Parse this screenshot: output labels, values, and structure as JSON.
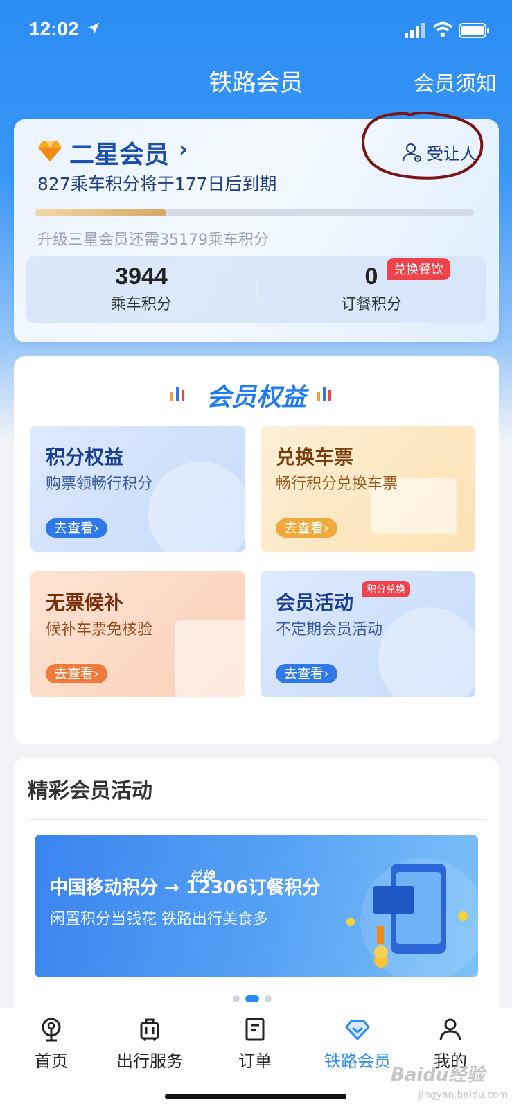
{
  "status_bar": {
    "time": "12:02"
  },
  "nav": {
    "title": "铁路会员",
    "notice": "会员须知"
  },
  "member": {
    "level": "二星会员",
    "expire_notice": "827乘车积分将于177日后到期",
    "transferee_label": "受让人",
    "progress_fraction": 0.3,
    "upgrade_notice": "升级三星会员还需35179乘车积分",
    "ride_points": {
      "value": "3944",
      "label": "乘车积分"
    },
    "meal_points": {
      "value": "0",
      "label": "订餐积分",
      "badge": "兑换餐饮"
    }
  },
  "benefits": {
    "title": "会员权益",
    "tiles": [
      {
        "title": "积分权益",
        "subtitle": "购票领畅行积分",
        "button": "去查看›",
        "accent": "#2f78e8"
      },
      {
        "title": "兑换车票",
        "subtitle": "畅行积分兑换车票",
        "button": "去查看›",
        "accent": "#f0a93a"
      },
      {
        "title": "无票候补",
        "subtitle": "候补车票免核验",
        "button": "去查看›",
        "accent": "#f07a3a"
      },
      {
        "title": "会员活动",
        "subtitle": "不定期会员活动",
        "button": "去查看›",
        "badge": "积分兑换",
        "accent": "#2f78e8"
      }
    ]
  },
  "activities": {
    "title": "精彩会员活动",
    "banner": {
      "title": "中国移动积分 → 12306订餐积分",
      "tag": "兑换",
      "subtitle": "闲置积分当钱花 铁路出行美食多"
    },
    "carousel_active_index": 1
  },
  "tabs": [
    {
      "label": "首页",
      "icon": "railway-logo-icon"
    },
    {
      "label": "出行服务",
      "icon": "luggage-icon"
    },
    {
      "label": "订单",
      "icon": "order-list-icon"
    },
    {
      "label": "铁路会员",
      "icon": "diamond-icon",
      "active": true
    },
    {
      "label": "我的",
      "icon": "person-icon"
    }
  ],
  "watermark": {
    "text": "Baidu经验",
    "sub": "jingyan.baidu.com"
  }
}
